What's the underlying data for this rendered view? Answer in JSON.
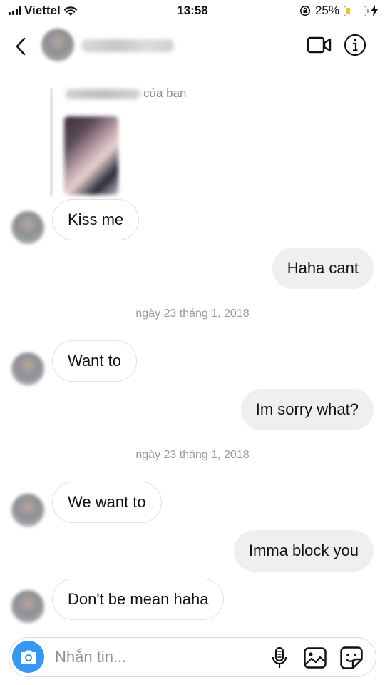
{
  "status_bar": {
    "carrier": "Viettel",
    "time": "13:58",
    "battery_percent": "25%",
    "battery_level": 0.25,
    "battery_color": "#f5c02c"
  },
  "header": {
    "back_icon": "chevron-left-icon",
    "video_icon": "video-camera-icon",
    "info_icon": "info-icon"
  },
  "chat": {
    "reply_caption": "của bạn",
    "messages": [
      {
        "side": "in",
        "text": "Kiss me"
      },
      {
        "side": "out",
        "text": "Haha cant"
      },
      {
        "side": "date",
        "text": "ngày 23 tháng 1, 2018"
      },
      {
        "side": "in",
        "text": "Want to"
      },
      {
        "side": "out",
        "text": "Im sorry what?"
      },
      {
        "side": "date",
        "text": "ngày 23 tháng 1, 2018"
      },
      {
        "side": "in",
        "text": "We want to"
      },
      {
        "side": "out",
        "text": "Imma block you"
      },
      {
        "side": "in",
        "text": "Don't be mean haha"
      }
    ]
  },
  "composer": {
    "placeholder": "Nhắn tin...",
    "accent_color": "#3897f0",
    "camera_icon": "camera-icon",
    "mic_icon": "microphone-icon",
    "gallery_icon": "image-icon",
    "sticker_icon": "sticker-icon"
  }
}
